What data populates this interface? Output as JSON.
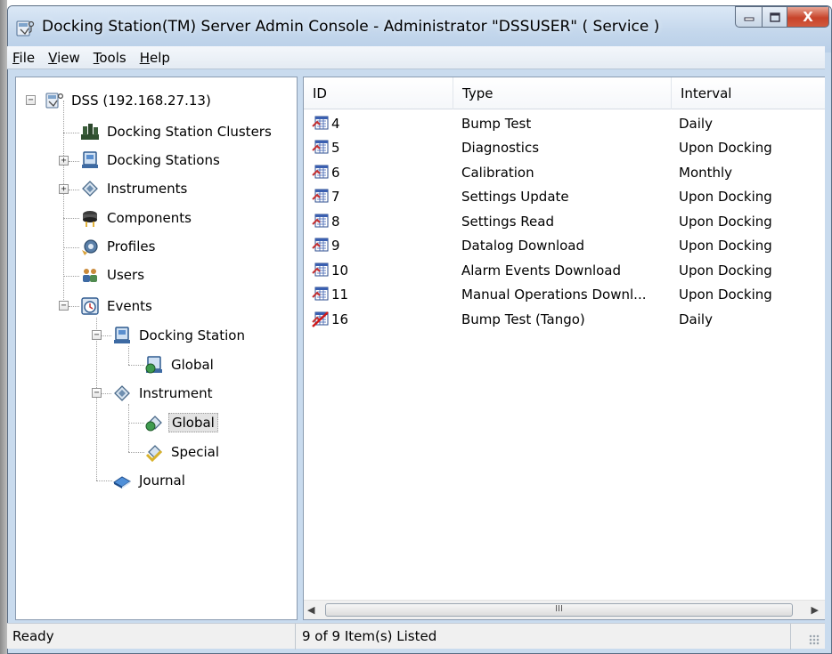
{
  "window": {
    "title": "Docking Station(TM) Server Admin Console - Administrator \"DSSUSER\" ( Service )",
    "icon": "server-admin-icon"
  },
  "menu": {
    "items": [
      {
        "label": "File",
        "accel": "F",
        "rest": "ile"
      },
      {
        "label": "View",
        "accel": "V",
        "rest": "iew"
      },
      {
        "label": "Tools",
        "accel": "T",
        "rest": "ools"
      },
      {
        "label": "Help",
        "accel": "H",
        "rest": "elp"
      }
    ]
  },
  "tree": {
    "root": "DSS (192.168.27.13)",
    "items": {
      "clusters": "Docking Station Clusters",
      "stations": "Docking Stations",
      "instruments": "Instruments",
      "components": "Components",
      "profiles": "Profiles",
      "users": "Users",
      "events": "Events",
      "events_docking_station": "Docking Station",
      "events_docking_station_global": "Global",
      "events_instrument": "Instrument",
      "events_instrument_global": "Global",
      "events_instrument_special": "Special",
      "journal": "Journal"
    },
    "selected": "events_instrument_global"
  },
  "list": {
    "columns": {
      "id": "ID",
      "type": "Type",
      "interval": "Interval"
    },
    "rows": [
      {
        "id": "4",
        "type": "Bump Test",
        "interval": "Daily",
        "icon": "event-enabled-icon"
      },
      {
        "id": "5",
        "type": "Diagnostics",
        "interval": "Upon Docking",
        "icon": "event-enabled-icon"
      },
      {
        "id": "6",
        "type": "Calibration",
        "interval": "Monthly",
        "icon": "event-enabled-icon"
      },
      {
        "id": "7",
        "type": "Settings Update",
        "interval": "Upon Docking",
        "icon": "event-enabled-icon"
      },
      {
        "id": "8",
        "type": "Settings Read",
        "interval": "Upon Docking",
        "icon": "event-enabled-icon"
      },
      {
        "id": "9",
        "type": "Datalog Download",
        "interval": "Upon Docking",
        "icon": "event-enabled-icon"
      },
      {
        "id": "10",
        "type": "Alarm Events Download",
        "interval": "Upon Docking",
        "icon": "event-enabled-icon"
      },
      {
        "id": "11",
        "type": "Manual Operations Downl...",
        "interval": "Upon Docking",
        "icon": "event-enabled-icon"
      },
      {
        "id": "16",
        "type": "Bump Test (Tango)",
        "interval": "Daily",
        "icon": "event-disabled-icon"
      }
    ],
    "hscroll_grip": "III"
  },
  "status": {
    "left": "Ready",
    "count": "9 of 9 Item(s) Listed"
  },
  "colors": {
    "frame": "#c9dbee",
    "selection": "#e3e3e3",
    "close_button": "#c7432a"
  }
}
